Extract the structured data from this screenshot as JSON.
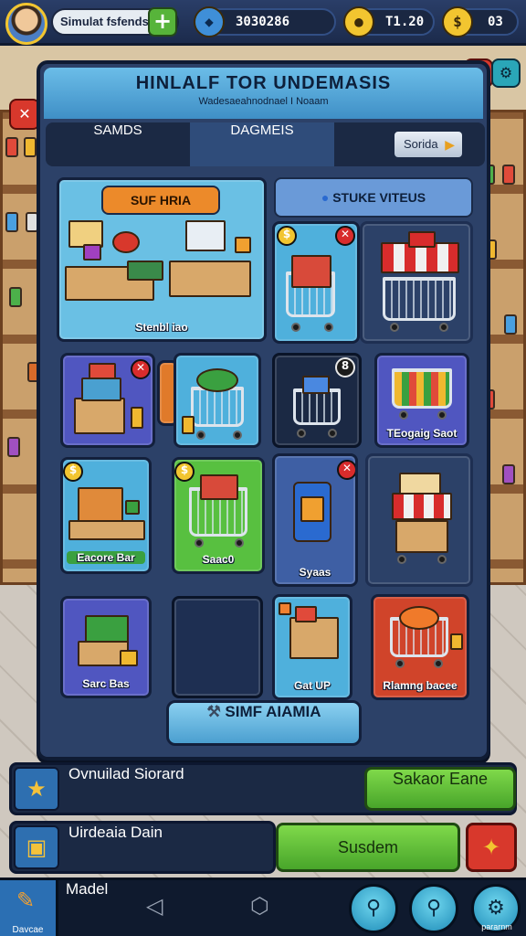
{
  "player": {
    "name": "Simulat fsfends",
    "add_label": "+"
  },
  "stats": [
    {
      "value": "3030286",
      "icon": "gem-icon",
      "color": "#3f8fd8"
    },
    {
      "value": "T1.20",
      "icon": "coin-icon",
      "color": "#f2c530"
    },
    {
      "value": "03",
      "icon": "dollar-icon",
      "color": "#f2c530"
    }
  ],
  "panel": {
    "title": "HINLALF TOR UNDEMASIS",
    "subtitle": "Wadesaeahnodnael I Noaam",
    "tabs": [
      "SAMDS",
      "DAGMEIS"
    ],
    "sort_label": "Sorida",
    "banners": {
      "left": "SUF HRIA",
      "right": "STUKE VITEUS"
    },
    "cards": [
      {
        "label": "Stenbl iao"
      },
      {
        "label": ""
      },
      {
        "label": ""
      },
      {
        "label": ""
      },
      {
        "label": ""
      },
      {
        "label": ""
      },
      {
        "label": "TEogaig Saot"
      },
      {
        "label": "Eacore Bar"
      },
      {
        "label": "Saac0"
      },
      {
        "label": "Syaas"
      },
      {
        "label": ""
      },
      {
        "label": "Sarc Bas"
      },
      {
        "label": ""
      },
      {
        "label": "Gat UP"
      },
      {
        "label": "Rlamng bacee"
      }
    ],
    "badges": {
      "card3": "8"
    },
    "action_label": "SIMF AIAMIA"
  },
  "quests": [
    {
      "text": "Ovnuilad Siorard",
      "button": "Sakaor Eane"
    },
    {
      "text": "Uirdeaia Dain",
      "button": "Susdem"
    }
  ],
  "navbar": {
    "home_label": "Davcae",
    "model_label": "Madel",
    "settings_label": "pararnm"
  },
  "colors": {
    "panel": "#2c4168",
    "accent_blue": "#4b9fd0",
    "accent_green": "#48a52a",
    "badge_red": "#d82c2c"
  }
}
